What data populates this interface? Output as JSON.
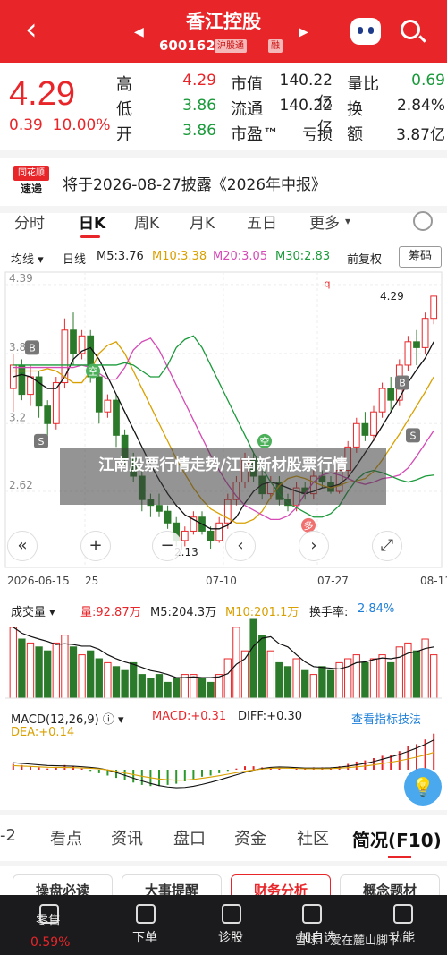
{
  "header": {
    "title": "香江控股",
    "code": "600162",
    "badge1": "沪股通",
    "badge2": "融"
  },
  "quote": {
    "price": "4.29",
    "change": "0.39",
    "change_pct": "10.00%",
    "rows": [
      {
        "l1": "高",
        "v1": "4.29",
        "c1": "red",
        "l2": "市值",
        "v2": "140.22亿",
        "l3": "量比",
        "v3": "0.69",
        "c3": "green"
      },
      {
        "l1": "低",
        "v1": "3.86",
        "c1": "green",
        "l2": "流通",
        "v2": "140.22亿",
        "l3": "换",
        "v3": "2.84%",
        "c3": "blk"
      },
      {
        "l1": "开",
        "v1": "3.86",
        "c1": "green",
        "l2": "市盈™",
        "v2": "亏损",
        "l3": "额",
        "v3": "3.87亿",
        "c3": "blk"
      }
    ]
  },
  "announcement": {
    "logo_top": "同花顺",
    "logo_bottom": "速递",
    "text": "将于2026-08-27披露《2026年中报》"
  },
  "tabs": [
    "分时",
    "日K",
    "周K",
    "月K",
    "五日",
    "更多"
  ],
  "indicators": {
    "ma": "均线",
    "line": "日线",
    "m5": "M5:3.76",
    "m10": "M10:3.38",
    "m20": "M20:3.05",
    "m30": "M30:2.83",
    "adjust": "前复权",
    "chips": "筹码"
  },
  "chart_data": {
    "type": "candlestick",
    "y_ticks": [
      "4.39",
      "3.80",
      "3.2",
      "2.62"
    ],
    "x_ticks": [
      "2026-06-15",
      "25",
      "07-10",
      "07-27",
      "08-11"
    ],
    "annotations": {
      "high": "4.29",
      "low": "2.13",
      "markers": [
        "B",
        "S",
        "B",
        "S",
        "空",
        "空",
        "多",
        "q"
      ]
    },
    "candles": [
      [
        3.5,
        3.7,
        3.3,
        3.8
      ],
      [
        3.7,
        3.45,
        3.4,
        3.75
      ],
      [
        3.45,
        3.6,
        3.35,
        3.7
      ],
      [
        3.6,
        3.35,
        3.25,
        3.65
      ],
      [
        3.35,
        3.2,
        3.0,
        3.4
      ],
      [
        3.2,
        3.55,
        3.15,
        3.6
      ],
      [
        3.55,
        4.0,
        3.5,
        4.1
      ],
      [
        4.0,
        3.8,
        3.7,
        4.15
      ],
      [
        3.8,
        3.95,
        3.75,
        4.0
      ],
      [
        3.95,
        3.6,
        3.55,
        4.0
      ],
      [
        3.6,
        3.3,
        3.2,
        3.65
      ],
      [
        3.3,
        3.4,
        3.25,
        3.45
      ],
      [
        3.4,
        3.1,
        3.0,
        3.45
      ],
      [
        3.1,
        2.9,
        2.85,
        3.15
      ],
      [
        2.9,
        2.75,
        2.7,
        2.95
      ],
      [
        2.75,
        2.55,
        2.45,
        2.8
      ],
      [
        2.55,
        2.5,
        2.4,
        2.6
      ],
      [
        2.5,
        2.45,
        2.4,
        2.6
      ],
      [
        2.45,
        2.35,
        2.3,
        2.5
      ],
      [
        2.35,
        2.2,
        2.15,
        2.4
      ],
      [
        2.2,
        2.28,
        2.15,
        2.32
      ],
      [
        2.28,
        2.4,
        2.25,
        2.45
      ],
      [
        2.4,
        2.28,
        2.25,
        2.45
      ],
      [
        2.28,
        2.2,
        2.13,
        2.32
      ],
      [
        2.2,
        2.35,
        2.18,
        2.4
      ],
      [
        2.35,
        2.55,
        2.3,
        2.6
      ],
      [
        2.55,
        2.7,
        2.5,
        2.75
      ],
      [
        2.7,
        2.9,
        2.65,
        2.95
      ],
      [
        2.9,
        2.75,
        2.7,
        2.95
      ],
      [
        2.75,
        2.6,
        2.55,
        2.8
      ],
      [
        2.6,
        2.7,
        2.55,
        2.75
      ],
      [
        2.7,
        2.55,
        2.5,
        2.75
      ],
      [
        2.55,
        2.5,
        2.45,
        2.6
      ],
      [
        2.5,
        2.65,
        2.45,
        2.7
      ],
      [
        2.65,
        2.6,
        2.55,
        2.7
      ],
      [
        2.6,
        2.75,
        2.55,
        2.8
      ],
      [
        2.75,
        2.7,
        2.65,
        2.8
      ],
      [
        2.7,
        2.62,
        2.6,
        2.75
      ],
      [
        2.62,
        2.8,
        2.6,
        2.85
      ],
      [
        2.8,
        3.0,
        2.75,
        3.05
      ],
      [
        3.0,
        3.2,
        2.95,
        3.25
      ],
      [
        3.2,
        3.1,
        3.05,
        3.3
      ],
      [
        3.1,
        3.3,
        3.05,
        3.35
      ],
      [
        3.3,
        3.5,
        3.25,
        3.55
      ],
      [
        3.5,
        3.4,
        3.3,
        3.6
      ],
      [
        3.4,
        3.7,
        3.35,
        3.75
      ],
      [
        3.7,
        3.9,
        3.65,
        3.95
      ],
      [
        3.9,
        3.85,
        3.7,
        4.0
      ],
      [
        3.85,
        4.1,
        3.8,
        4.15
      ],
      [
        4.1,
        4.29,
        4.05,
        4.29
      ]
    ],
    "ma5": [
      3.6,
      3.62,
      3.6,
      3.55,
      3.5,
      3.5,
      3.6,
      3.75,
      3.82,
      3.85,
      3.75,
      3.6,
      3.45,
      3.3,
      3.15,
      3.0,
      2.85,
      2.72,
      2.6,
      2.5,
      2.42,
      2.38,
      2.34,
      2.3,
      2.3,
      2.33,
      2.4,
      2.52,
      2.62,
      2.68,
      2.7,
      2.68,
      2.65,
      2.62,
      2.6,
      2.62,
      2.65,
      2.66,
      2.68,
      2.74,
      2.84,
      2.95,
      3.06,
      3.18,
      3.3,
      3.42,
      3.55,
      3.66,
      3.76,
      3.9
    ],
    "volume": {
      "label": "成交量",
      "vol": "量:92.87万",
      "m5": "M5:204.3万",
      "m10": "M10:201.1万",
      "turnover_label": "换手率:",
      "turnover": "2.84%",
      "bars": [
        0.9,
        0.75,
        0.7,
        0.65,
        0.6,
        0.7,
        0.8,
        0.65,
        0.55,
        0.6,
        0.5,
        0.45,
        0.4,
        0.35,
        0.45,
        0.3,
        0.25,
        0.3,
        0.2,
        0.25,
        0.3,
        0.3,
        0.25,
        0.2,
        0.3,
        0.5,
        0.9,
        0.6,
        1.0,
        0.8,
        0.6,
        0.45,
        0.4,
        0.5,
        0.35,
        0.3,
        0.4,
        0.35,
        0.45,
        0.5,
        0.55,
        0.45,
        0.5,
        0.55,
        0.45,
        0.65,
        0.7,
        0.6,
        0.75,
        0.55
      ]
    },
    "macd": {
      "label": "MACD(12,26,9)",
      "macd": "MACD:+0.31",
      "diff": "DIFF:+0.30",
      "dea": "DEA:+0.14",
      "link": "查看指标技法",
      "hist": [
        0.05,
        0.04,
        0.03,
        0.02,
        0.01,
        0.02,
        0.04,
        0.03,
        0.01,
        -0.01,
        -0.03,
        -0.05,
        -0.07,
        -0.09,
        -0.11,
        -0.13,
        -0.14,
        -0.14,
        -0.13,
        -0.12,
        -0.1,
        -0.08,
        -0.06,
        -0.05,
        -0.03,
        -0.01,
        0.01,
        0.03,
        0.03,
        0.02,
        0.02,
        0.01,
        0.0,
        0.01,
        0.01,
        0.02,
        0.02,
        0.02,
        0.03,
        0.05,
        0.07,
        0.08,
        0.1,
        0.12,
        0.13,
        0.16,
        0.2,
        0.22,
        0.26,
        0.31
      ]
    }
  },
  "overlay": "江南股票行情走势/江南新材股票行情",
  "bottom_tabs": [
    "-2",
    "看点",
    "资讯",
    "盘口",
    "资金",
    "社区",
    "简况(F10)"
  ],
  "bottom_buttons": [
    "操盘必读",
    "大事提醒",
    "财务分析",
    "概念题材"
  ],
  "nav": [
    {
      "label": "零售",
      "sub": "0.59%"
    },
    {
      "label": "下单"
    },
    {
      "label": "诊股"
    },
    {
      "label": "加自选"
    },
    {
      "label": "功能"
    }
  ],
  "watermark": "雪球：爱在麓山脚下"
}
